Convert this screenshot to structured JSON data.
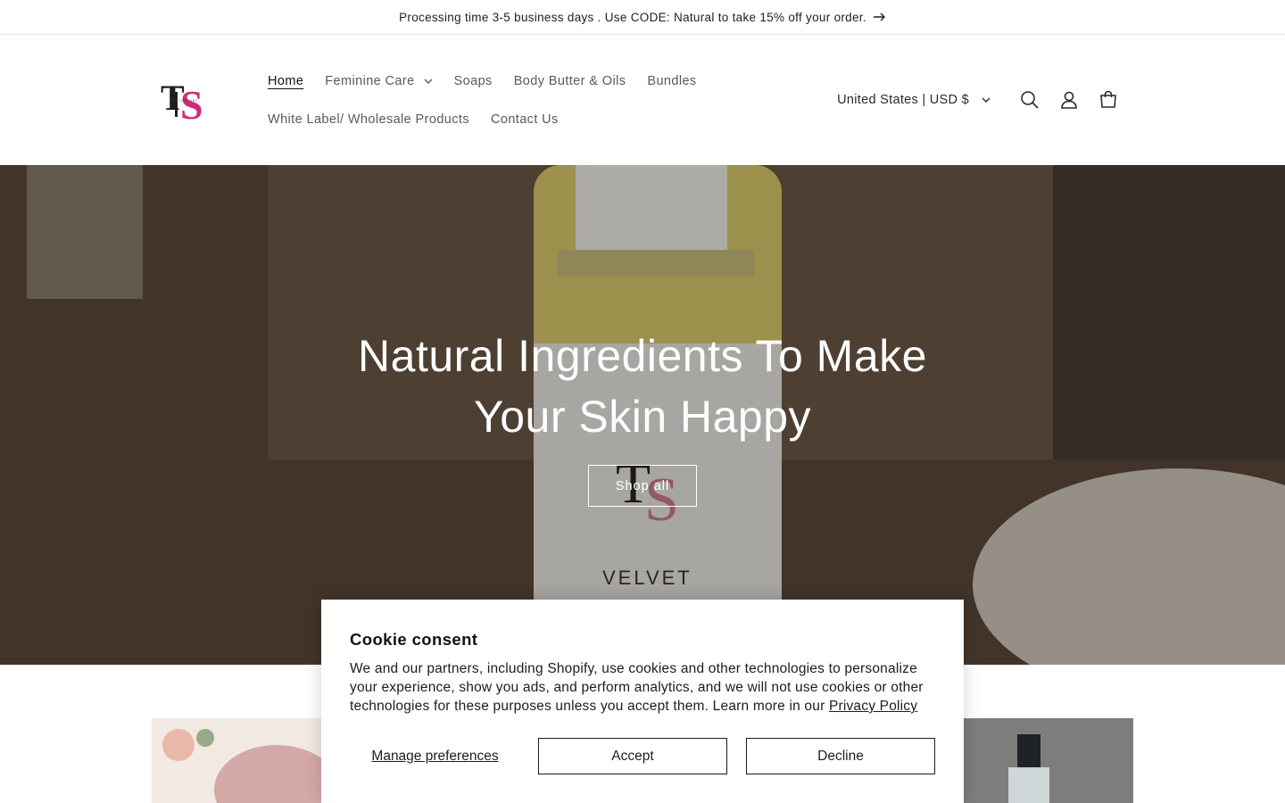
{
  "announcement": {
    "text": "Processing time 3-5 business days . Use CODE: Natural to take 15% off your order."
  },
  "header": {
    "logo_alt": "TS Skin Company",
    "nav_row1": [
      {
        "label": "Home",
        "active": true
      },
      {
        "label": "Feminine Care",
        "has_dropdown": true
      },
      {
        "label": "Soaps"
      },
      {
        "label": "Body Butter & Oils"
      },
      {
        "label": "Bundles"
      }
    ],
    "nav_row2": [
      {
        "label": "White Label/ Wholesale Products"
      },
      {
        "label": "Contact Us"
      }
    ],
    "country_selector": "United States | USD $",
    "icons": [
      "search-icon",
      "account-icon",
      "cart-icon"
    ]
  },
  "hero": {
    "title": "Natural Ingredients To Make Your Skin Happy",
    "button": "Shop all"
  },
  "cookie": {
    "title": "Cookie consent",
    "text": "We and our partners, including Shopify, use cookies and other technologies to personalize your experience, show you ads, and perform analytics, and we will not use cookies or other technologies for these purposes unless you accept them. Learn more in our ",
    "link": "Privacy Policy",
    "manage": "Manage preferences",
    "accept": "Accept",
    "decline": "Decline"
  },
  "colors": {
    "brand_pink": "#d1287a",
    "logo_dark": "#1e1e1e",
    "text": "#121212"
  }
}
